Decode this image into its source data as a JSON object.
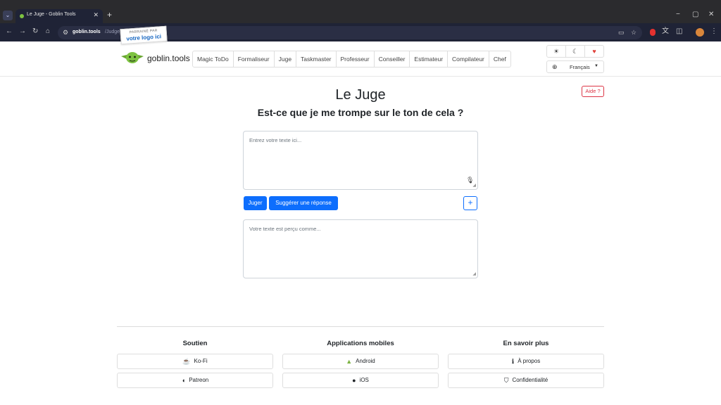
{
  "browser": {
    "tab_title": "Le Juge - Goblin Tools",
    "url_host": "goblin.tools",
    "url_path": "/Judge"
  },
  "header": {
    "brand": "goblin.tools",
    "sponsor_line1": "PARRAINÉ PAR",
    "sponsor_line2": "votre logo ici",
    "nav": [
      "Magic ToDo",
      "Formaliseur",
      "Juge",
      "Taskmaster",
      "Professeur",
      "Conseiller",
      "Estimateur",
      "Compilateur",
      "Chef"
    ],
    "language": "Français"
  },
  "main": {
    "help": "Aide ?",
    "title": "Le Juge",
    "subtitle": "Est-ce que je me trompe sur le ton de cela ?",
    "input_placeholder": "Entrez votre texte ici...",
    "judge_button": "Juger",
    "suggest_button": "Suggérer une réponse",
    "add_button": "+",
    "output_placeholder": "Votre texte est perçu comme..."
  },
  "footer": {
    "support_title": "Soutien",
    "kofi": "Ko-Fi",
    "patreon": "Patreon",
    "mobile_title": "Applications mobiles",
    "android": "Android",
    "ios": "iOS",
    "more_title": "En savoir plus",
    "about": "À propos",
    "privacy": "Confidentialité"
  }
}
